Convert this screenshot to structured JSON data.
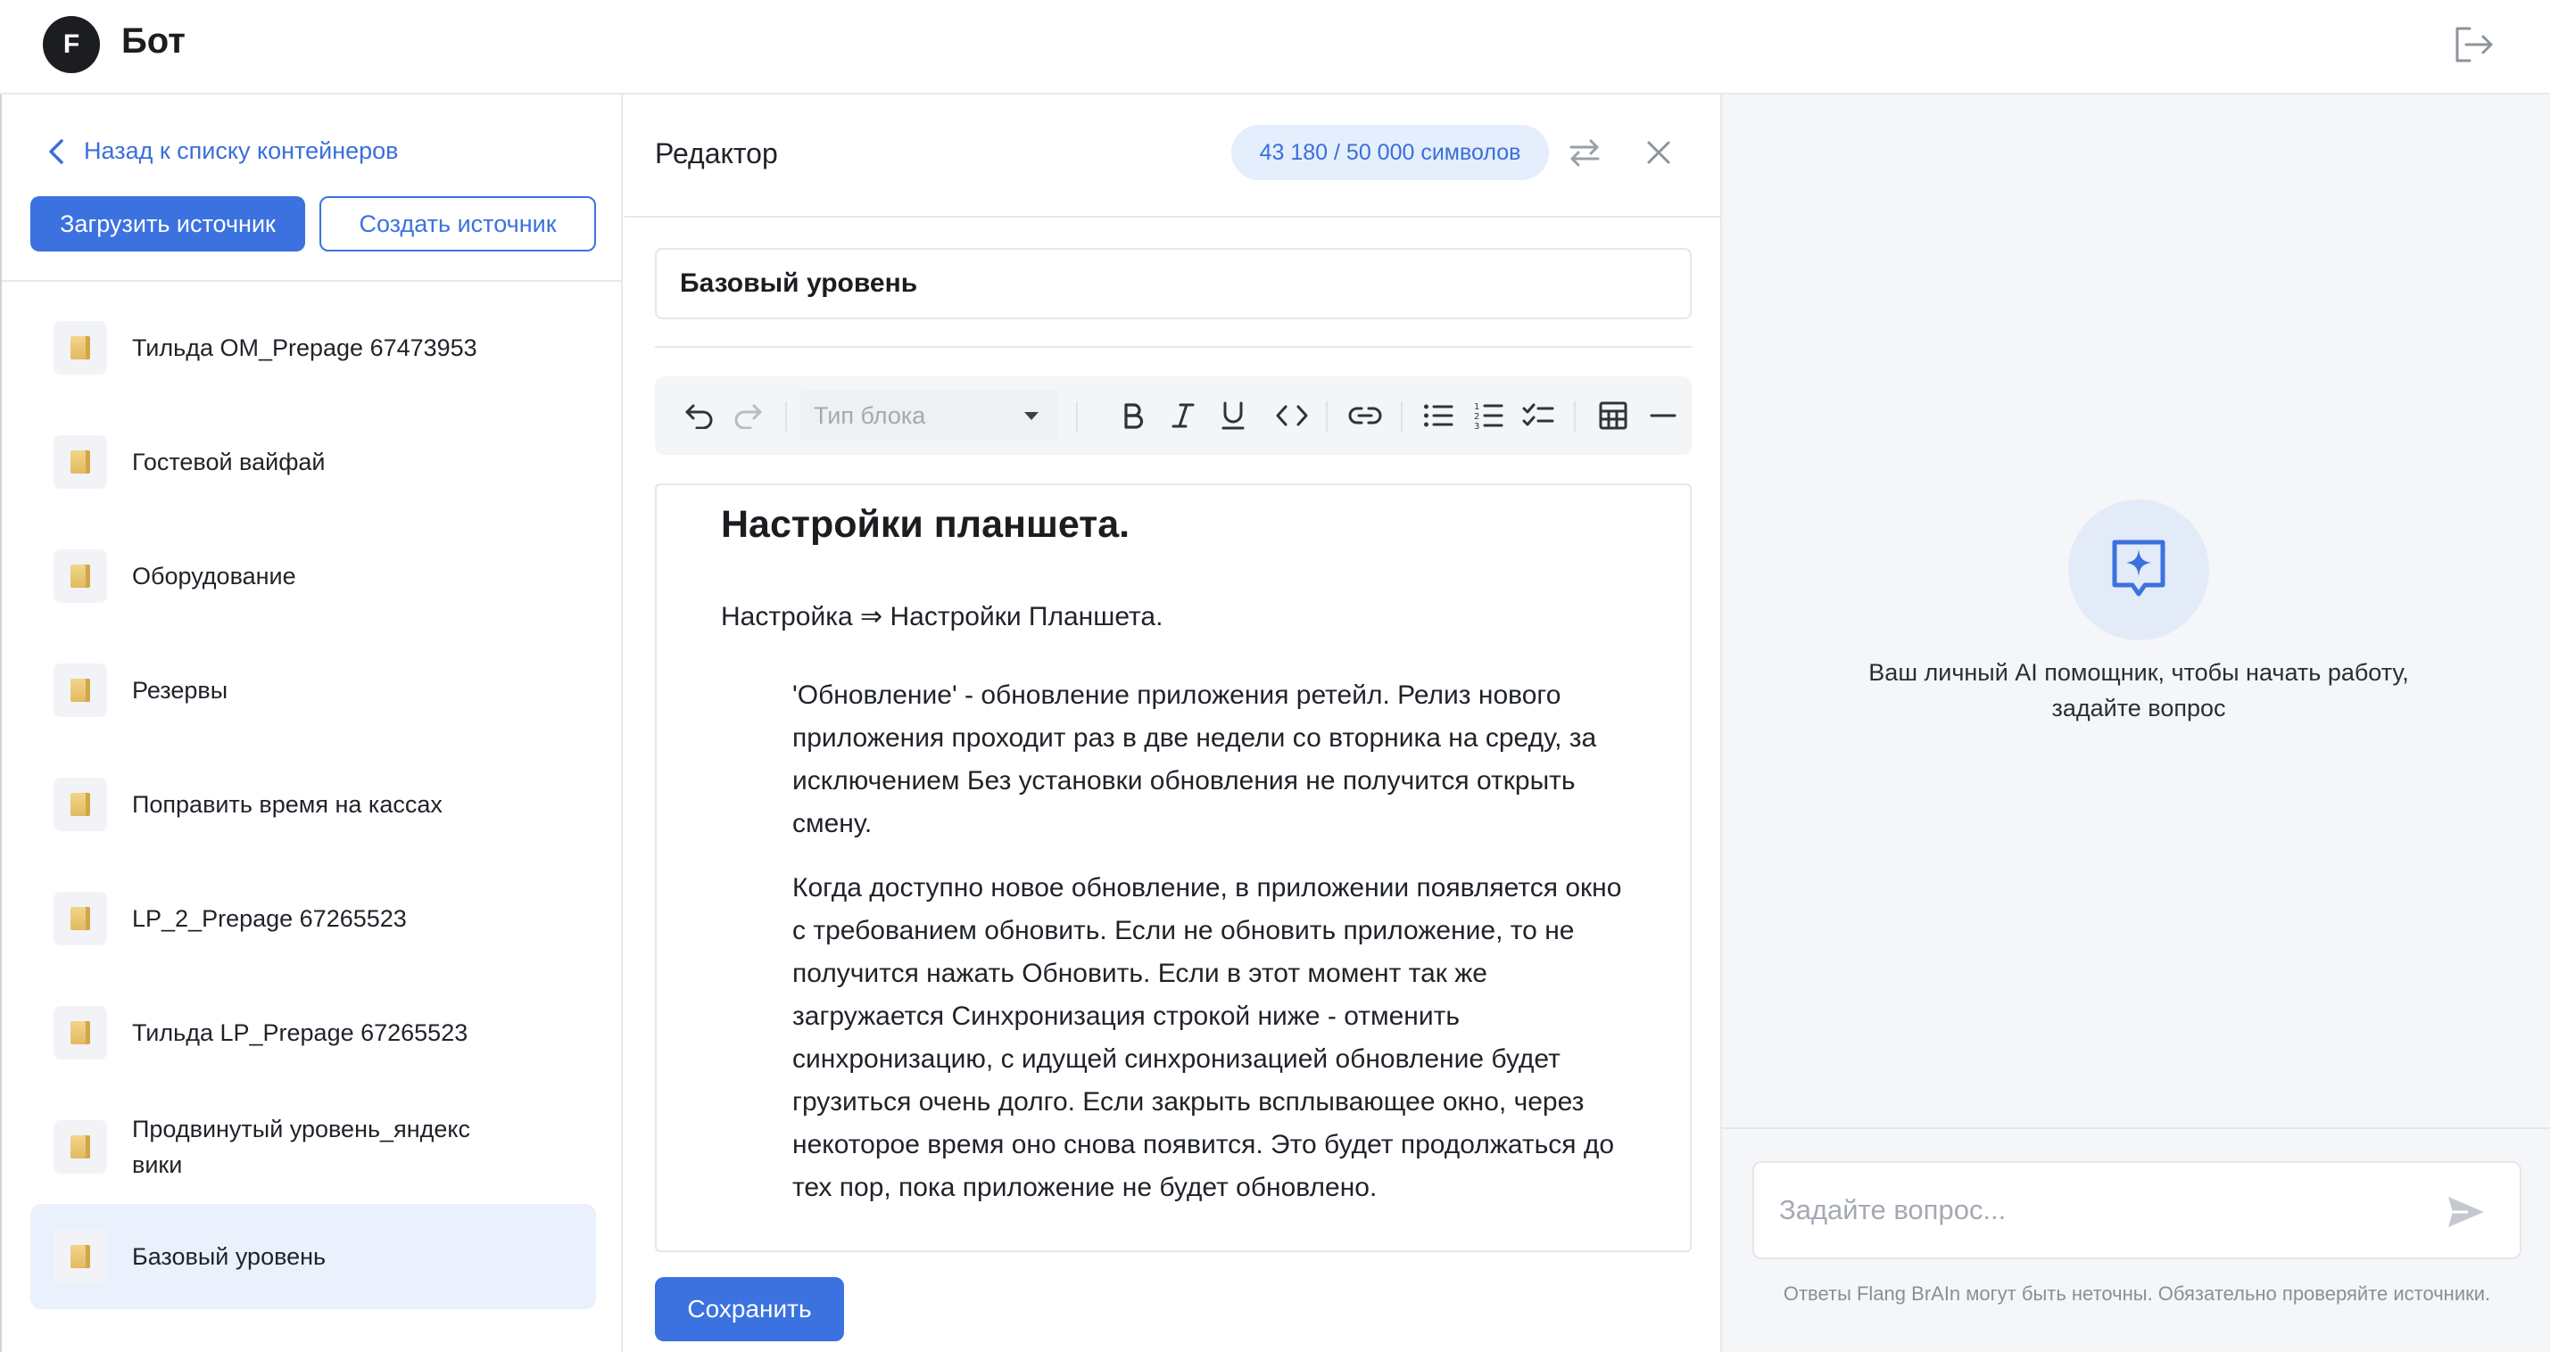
{
  "header": {
    "logo_letter": "F",
    "title": "Бот",
    "logout_icon": "logout-icon"
  },
  "sidebar": {
    "back_label": "Назад к списку контейнеров",
    "upload_label": "Загрузить источник",
    "create_label": "Создать источник",
    "items": [
      {
        "label": "Тильда OM_Prepage 67473953",
        "active": false
      },
      {
        "label": "Гостевой вайфай",
        "active": false
      },
      {
        "label": "Оборудование",
        "active": false
      },
      {
        "label": "Резервы",
        "active": false
      },
      {
        "label": "Поправить время на кассах",
        "active": false
      },
      {
        "label": "LP_2_Prepage 67265523",
        "active": false
      },
      {
        "label": "Тильда LP_Prepage 67265523",
        "active": false
      },
      {
        "label": "Продвинутый уровень_яндекс вики",
        "active": false
      },
      {
        "label": "Базовый уровень",
        "active": true
      }
    ]
  },
  "editor": {
    "title": "Редактор",
    "char_count": "43 180 / 50 000 символов",
    "doc_title": "Базовый уровень",
    "toolbar": {
      "block_type_placeholder": "Тип блока"
    },
    "content": {
      "heading": "Настройки планшета.",
      "path": "Настройка ⇒ Настройки Планшета.",
      "paragraph1": "'Обновление' - обновление приложения ретейл. Релиз нового приложения проходит раз в две недели со вторника на среду, за исключением Без установки обновления не получится открыть смену.",
      "paragraph2": "Когда доступно новое обновление, в приложении появляется окно с требованием обновить. Если не обновить приложение, то не получится нажать Обновить. Если в этот момент так же загружается Синхронизация строкой ниже - отменить синхронизацию, с идущей синхронизацией обновление будет грузиться очень долго. Если закрыть всплывающее окно, через некоторое время оно снова появится. Это будет продолжаться до тех пор, пока приложение не будет обновлено."
    },
    "save_label": "Сохранить"
  },
  "assistant": {
    "intro": "Ваш личный AI помощник, чтобы начать работу, задайте вопрос",
    "input_placeholder": "Задайте вопрос...",
    "disclaimer": "Ответы Flang BrAIn могут быть неточны. Обязательно проверяйте источники."
  },
  "colors": {
    "accent": "#3b72e0",
    "active_bg": "#eaf1fc",
    "badge_bg": "#e5eefc"
  }
}
